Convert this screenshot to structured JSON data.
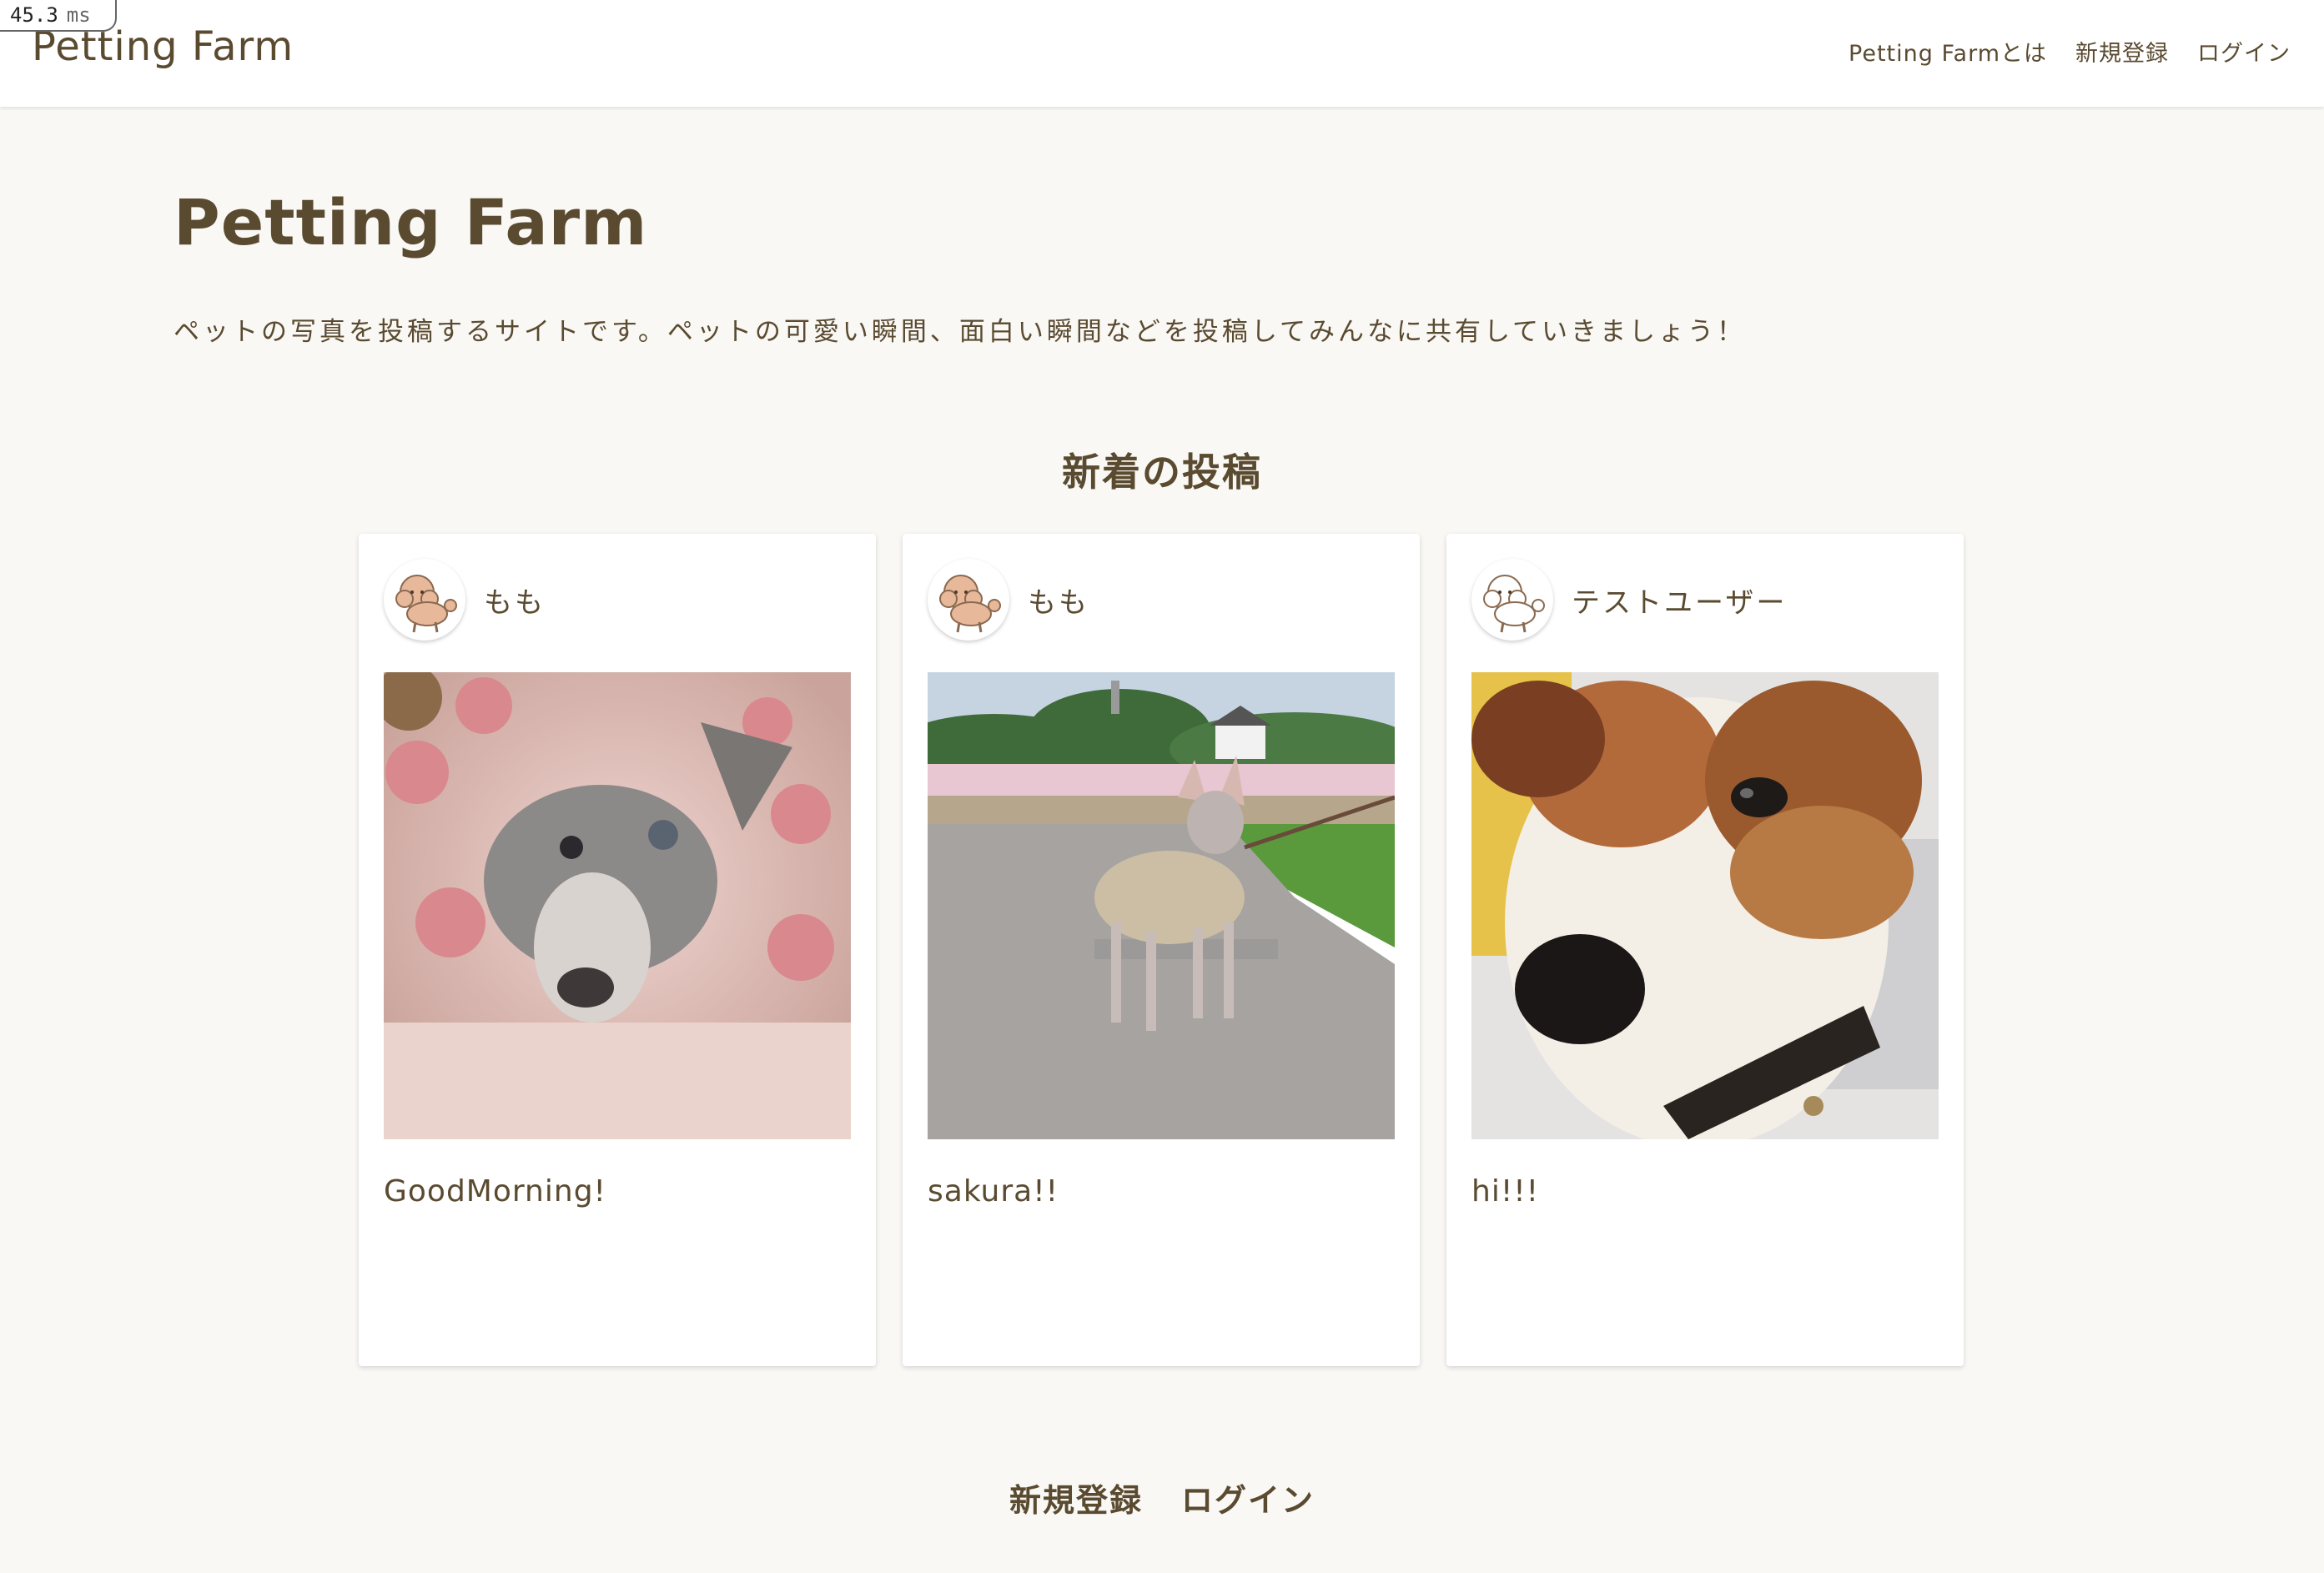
{
  "perf": {
    "value": "45.3",
    "unit": "ms"
  },
  "navbar": {
    "brand": "Petting Farm",
    "links": [
      "Petting Farmとは",
      "新規登録",
      "ログイン"
    ]
  },
  "hero": {
    "title": "Petting Farm",
    "description": "ペットの写真を投稿するサイトです。ペットの可愛い瞬間、面白い瞬間などを投稿してみんなに共有していきましょう！"
  },
  "posts_section": {
    "title": "新着の投稿",
    "posts": [
      {
        "username": "もも",
        "caption": "GoodMorning!"
      },
      {
        "username": "もも",
        "caption": "sakura!!"
      },
      {
        "username": "テストユーザー",
        "caption": "hi!!!"
      }
    ]
  },
  "footer": {
    "links": [
      "新規登録",
      "ログイン"
    ]
  },
  "colors": {
    "text": "#5a4a30",
    "background": "#f9f8f5",
    "card": "#ffffff"
  }
}
